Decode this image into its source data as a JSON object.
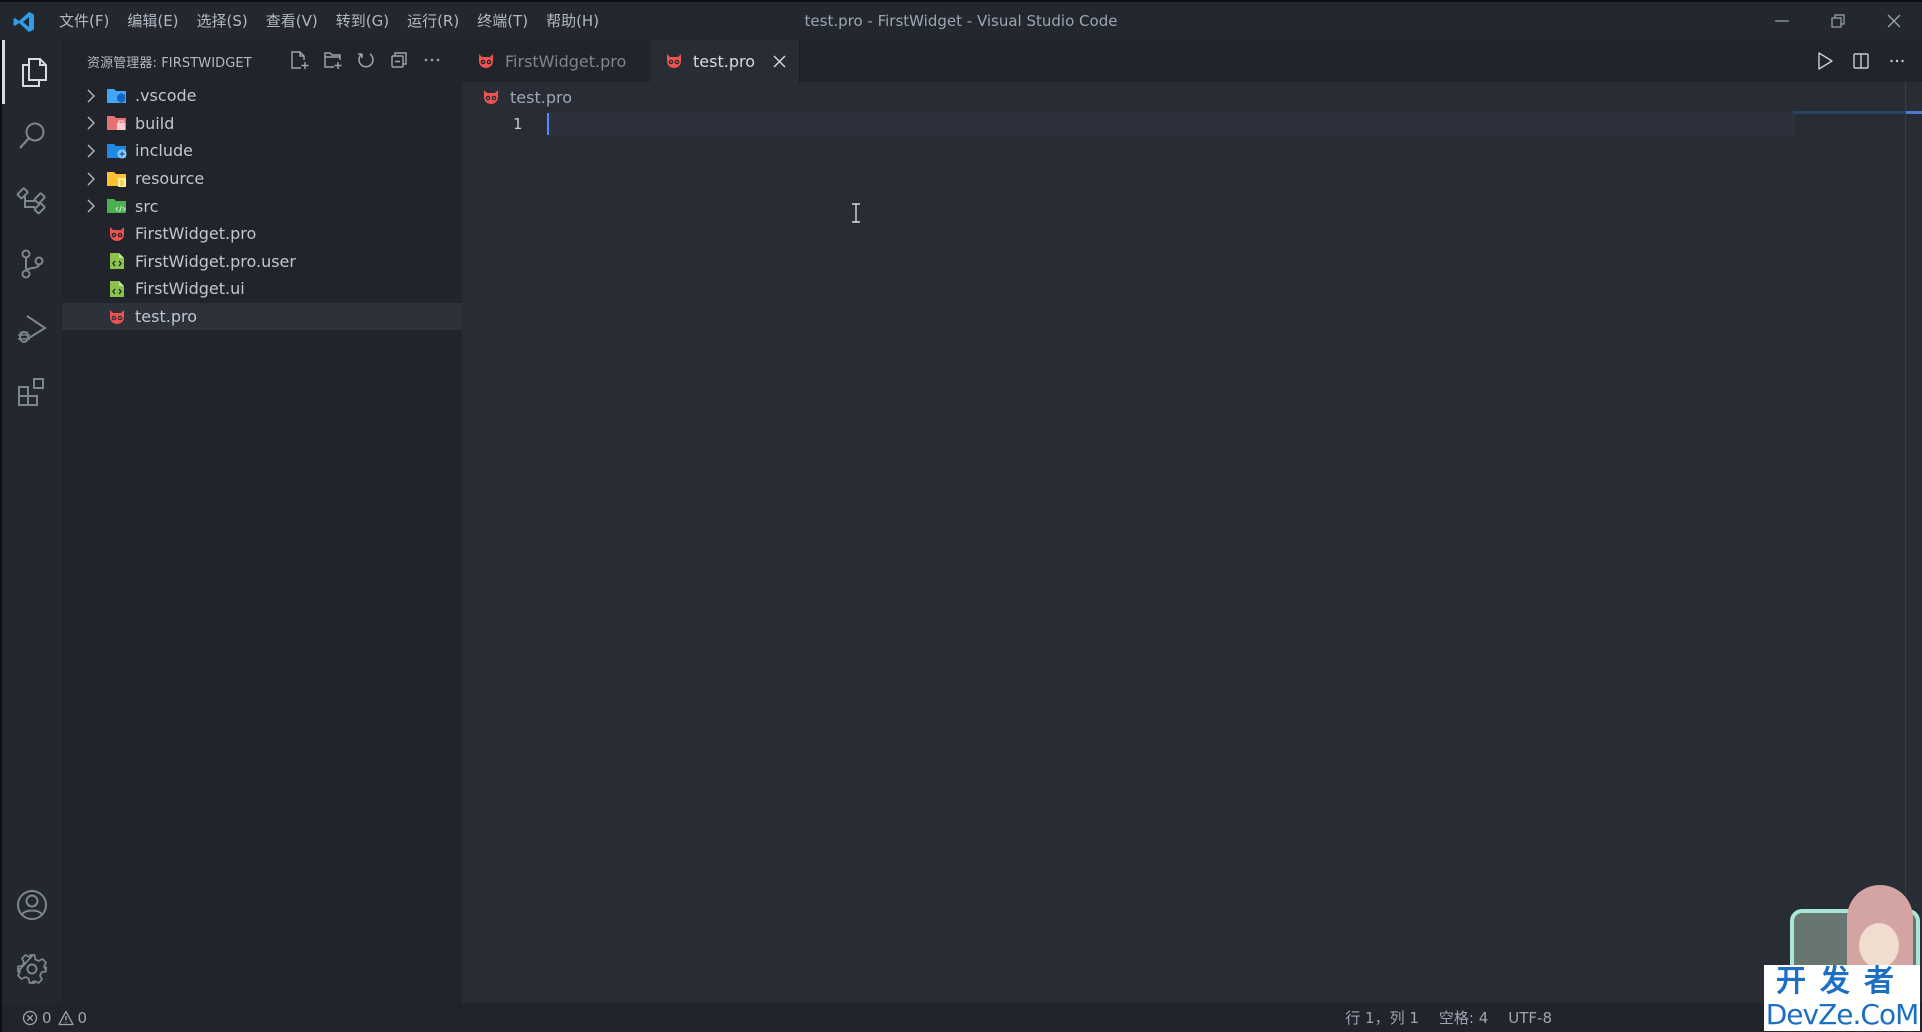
{
  "titlebar": {
    "menu": [
      "文件(F)",
      "编辑(E)",
      "选择(S)",
      "查看(V)",
      "转到(G)",
      "运行(R)",
      "终端(T)",
      "帮助(H)"
    ],
    "window_title": "test.pro - FirstWidget - Visual Studio Code",
    "controls": [
      "minimize",
      "restore",
      "close"
    ]
  },
  "activitybar": {
    "items": [
      {
        "name": "explorer",
        "icon": "files-icon",
        "active": true
      },
      {
        "name": "search",
        "icon": "search-icon",
        "active": false
      },
      {
        "name": "qt-project",
        "icon": "project-tree-icon",
        "active": false
      },
      {
        "name": "source-control",
        "icon": "source-control-icon",
        "active": false
      },
      {
        "name": "run-and-debug",
        "icon": "run-debug-icon",
        "active": false
      },
      {
        "name": "extensions",
        "icon": "extensions-icon",
        "active": false
      }
    ],
    "bottom": [
      {
        "name": "accounts",
        "icon": "account-icon"
      },
      {
        "name": "manage",
        "icon": "gear-icon"
      }
    ]
  },
  "sidebar": {
    "title": "资源管理器: FIRSTWIDGET",
    "actions": [
      "new-file",
      "new-folder",
      "refresh",
      "collapse-all",
      "more"
    ],
    "tree": [
      {
        "label": ".vscode",
        "type": "folder",
        "icon": "folder-vscode-icon",
        "color": "#42a5f5",
        "expanded": false
      },
      {
        "label": "build",
        "type": "folder",
        "icon": "folder-build-icon",
        "color": "#e57373",
        "expanded": false
      },
      {
        "label": "include",
        "type": "folder",
        "icon": "folder-include-icon",
        "color": "#1e88e5",
        "expanded": false
      },
      {
        "label": "resource",
        "type": "folder",
        "icon": "folder-resource-icon",
        "color": "#fbc02d",
        "expanded": false
      },
      {
        "label": "src",
        "type": "folder",
        "icon": "folder-src-icon",
        "color": "#4caf50",
        "expanded": false
      },
      {
        "label": "FirstWidget.pro",
        "type": "file",
        "icon": "qmake-pro-icon",
        "color": "#ef5350"
      },
      {
        "label": "FirstWidget.pro.user",
        "type": "file",
        "icon": "xml-file-icon",
        "color": "#8bc34a"
      },
      {
        "label": "FirstWidget.ui",
        "type": "file",
        "icon": "xml-file-icon",
        "color": "#8bc34a"
      },
      {
        "label": "test.pro",
        "type": "file",
        "icon": "qmake-pro-icon",
        "color": "#ef5350",
        "selected": true
      }
    ]
  },
  "tabs": [
    {
      "label": "FirstWidget.pro",
      "active": false
    },
    {
      "label": "test.pro",
      "active": true
    }
  ],
  "editor": {
    "breadcrumb": "test.pro",
    "lines": [
      {
        "number": "1",
        "text": ""
      }
    ],
    "cursor": {
      "line": 1,
      "column": 1
    }
  },
  "statusbar": {
    "errors": "0",
    "warnings": "0",
    "position": "行 1，列 1",
    "indent": "空格: 4",
    "encoding": "UTF-8"
  },
  "watermark": {
    "cn": "开发者",
    "en": "DevZe.CoM"
  },
  "colors": {
    "accent": "#528bff",
    "qmake": "#ef5350"
  }
}
